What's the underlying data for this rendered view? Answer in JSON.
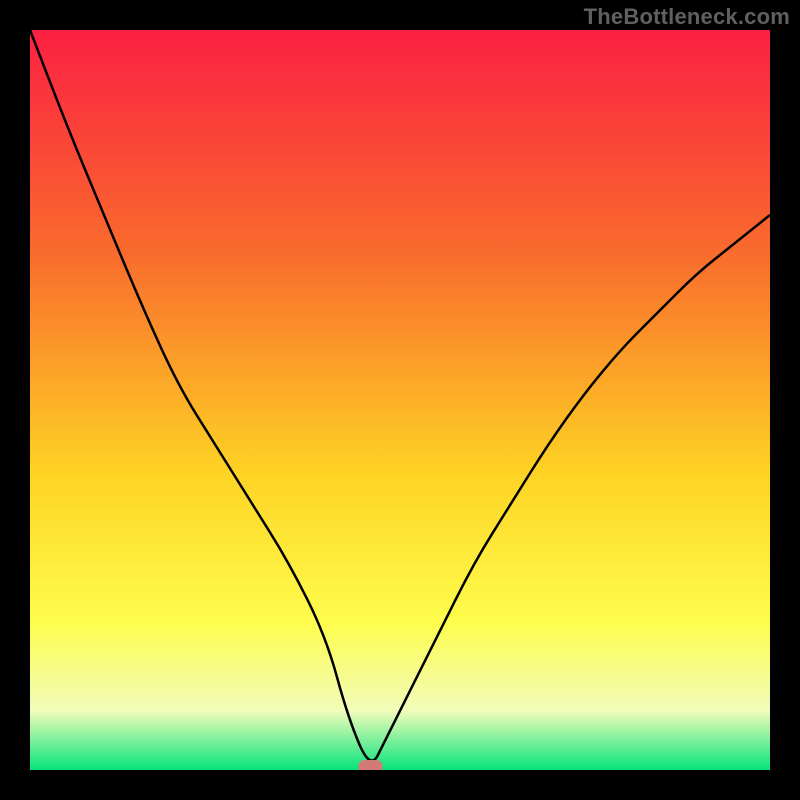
{
  "attribution": "TheBottleneck.com",
  "colors": {
    "gradient_top": "#fb2042",
    "gradient_upper_mid": "#f96b2d",
    "gradient_mid": "#fed324",
    "gradient_lower_mid": "#fefd4d",
    "gradient_near_bottom": "#f1fcba",
    "gradient_bottom": "#07e47c",
    "curve": "#000000",
    "marker": "#d27a75",
    "frame": "#000000"
  },
  "chart_data": {
    "type": "line",
    "title": "",
    "xlabel": "",
    "ylabel": "",
    "xlim": [
      0,
      100
    ],
    "ylim": [
      0,
      100
    ],
    "grid": false,
    "legend": false,
    "series": [
      {
        "name": "bottleneck-curve",
        "x": [
          0,
          5,
          10,
          15,
          20,
          25,
          30,
          35,
          40,
          43,
          46,
          48,
          55,
          60,
          65,
          70,
          75,
          80,
          85,
          90,
          95,
          100
        ],
        "y": [
          100,
          87,
          75,
          63,
          52,
          44,
          36,
          28,
          18,
          7,
          0,
          4,
          18,
          28,
          36,
          44,
          51,
          57,
          62,
          67,
          71,
          75
        ]
      }
    ],
    "marker": {
      "x": 46,
      "y": 0,
      "shape": "rounded-pill"
    },
    "background_gradient_stops": [
      {
        "offset": 0.0,
        "color": "#fb2042"
      },
      {
        "offset": 0.3,
        "color": "#f96b2d"
      },
      {
        "offset": 0.6,
        "color": "#fed324"
      },
      {
        "offset": 0.8,
        "color": "#fefd4d"
      },
      {
        "offset": 0.92,
        "color": "#f1fcba"
      },
      {
        "offset": 1.0,
        "color": "#07e47c"
      }
    ]
  }
}
